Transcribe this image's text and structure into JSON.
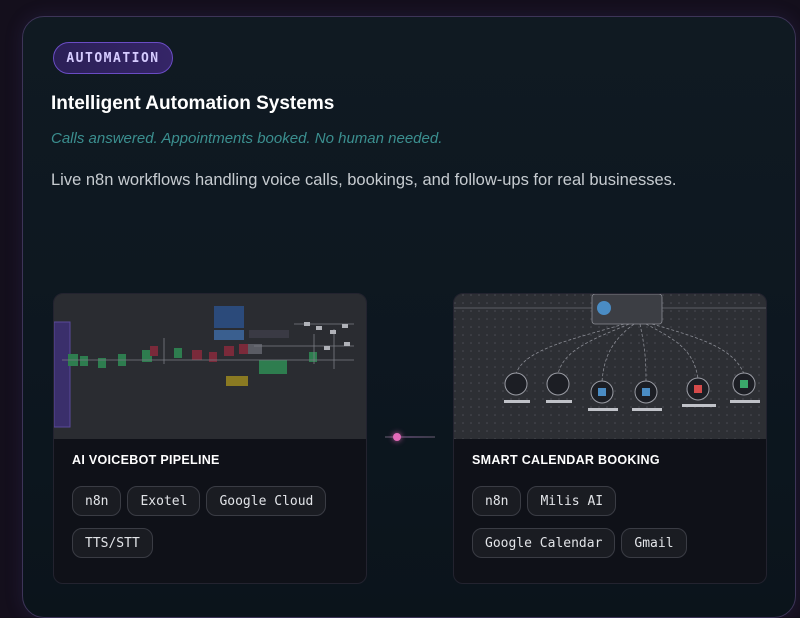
{
  "badge": "AUTOMATION",
  "title": "Intelligent Automation Systems",
  "tagline": "Calls answered. Appointments booked. No human needed.",
  "description": "Live n8n workflows handling voice calls, bookings, and follow-ups for real businesses.",
  "projects": [
    {
      "title": "AI VOICEBOT PIPELINE",
      "preview_icon": "workflow-screenshot-icon",
      "tags": [
        "n8n",
        "Exotel",
        "Google Cloud",
        "TTS/STT"
      ]
    },
    {
      "title": "SMART CALENDAR BOOKING",
      "preview_icon": "workflow-screenshot-icon",
      "tags": [
        "n8n",
        "Milis AI",
        "Google Calendar",
        "Gmail"
      ]
    }
  ],
  "colors": {
    "accent_purple": "#6a4cc4",
    "tagline_teal": "#3b8f8f",
    "connector_pink": "#e36ab8"
  }
}
